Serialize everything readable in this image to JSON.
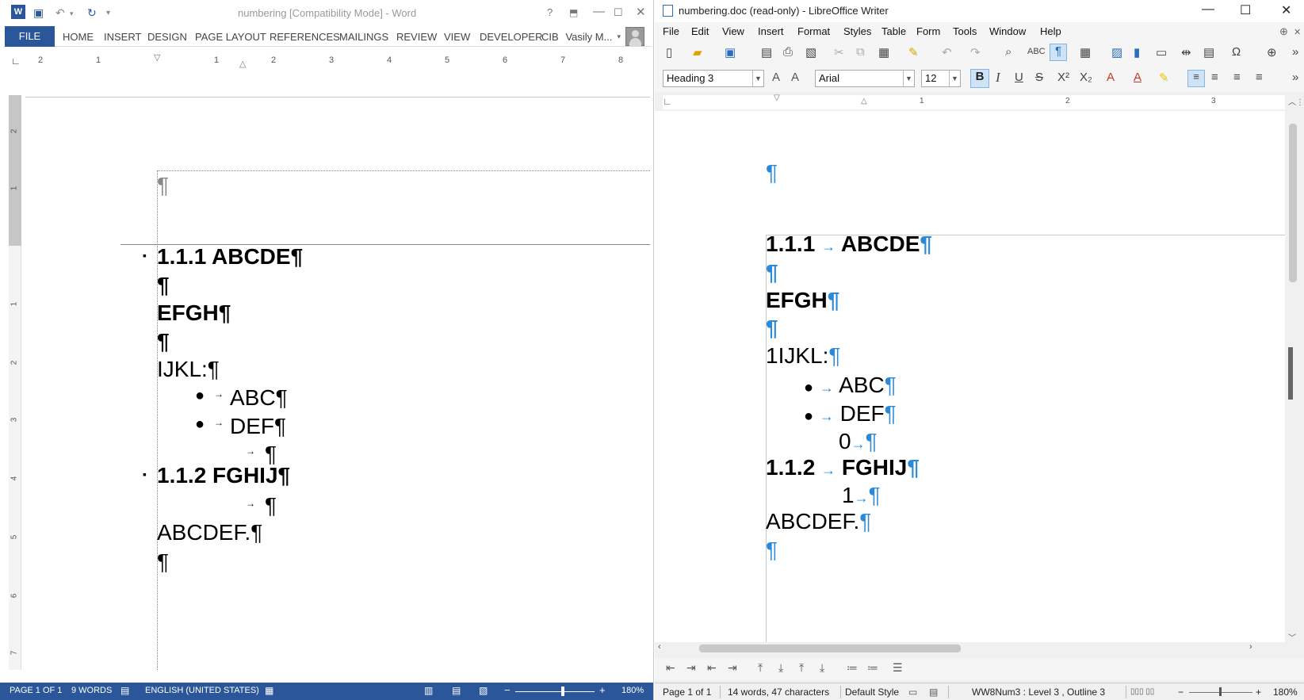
{
  "word": {
    "title": "numbering [Compatibility Mode] - Word",
    "help": "?",
    "tabs": [
      "FILE",
      "HOME",
      "INSERT",
      "DESIGN",
      "PAGE LAYOUT",
      "REFERENCES",
      "MAILINGS",
      "REVIEW",
      "VIEW",
      "DEVELOPER",
      "CIB"
    ],
    "user": "Vasily M...",
    "ruler_h": [
      "2",
      "1",
      "1",
      "2",
      "3",
      "4",
      "5",
      "6",
      "7",
      "8"
    ],
    "ruler_v": [
      "2",
      "1",
      "1",
      "2",
      "3",
      "4",
      "5",
      "6",
      "7"
    ],
    "doc": {
      "p1": "1.1.1 ABCDE¶",
      "p2": "¶",
      "p3": "EFGH¶",
      "p4": "¶",
      "p5": "IJKL:¶",
      "b1": "ABC¶",
      "b2": "DEF¶",
      "b3": "¶",
      "p6": "1.1.2 FGHIJ¶",
      "b4": "¶",
      "p7": "ABCDEF.¶",
      "p8": "¶",
      "hdr": "¶"
    },
    "status": {
      "page": "PAGE 1 OF 1",
      "words": "9 WORDS",
      "lang": "ENGLISH (UNITED STATES)",
      "zoom": "180%"
    }
  },
  "lo": {
    "title": "numbering.doc (read-only) - LibreOffice Writer",
    "menus": [
      "File",
      "Edit",
      "View",
      "Insert",
      "Format",
      "Styles",
      "Table",
      "Form",
      "Tools",
      "Window",
      "Help"
    ],
    "style": "Heading 3",
    "font": "Arial",
    "size": "12",
    "ruler": [
      "1",
      "2",
      "3"
    ],
    "doc": {
      "hdr": "¶",
      "p1num": "1.1.1",
      "p1": "ABCDE",
      "p2": "¶",
      "p3": "EFGH",
      "p4": "¶",
      "p5": "1IJKL:",
      "b1": "ABC",
      "b2": "DEF",
      "n0": "0",
      "p6num": "1.1.2",
      "p6": "FGHIJ",
      "n1": "1",
      "p7": "ABCDEF.",
      "p8": "¶",
      "pm": "¶",
      "arrow": "→",
      "bullet": "●"
    },
    "status": {
      "page": "Page 1 of 1",
      "words": "14 words, 47 characters",
      "style": "Default Style",
      "numbering": "WW8Num3 : Level 3 , Outline 3",
      "zoom": "180%"
    }
  }
}
